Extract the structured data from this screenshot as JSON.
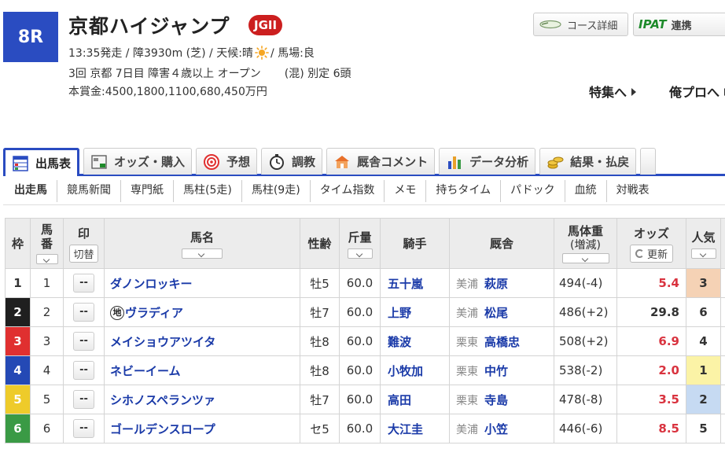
{
  "race": {
    "number": "8R",
    "name": "京都ハイジャンプ",
    "grade": "JGII",
    "data1_a": "13:35発走 / 障3930m (芝) / 天候:晴",
    "data1_b": "/ 馬場:良",
    "weather_icon": "sun-icon",
    "data2_a": "3回 京都 7日目 障害４歳以上 オープン",
    "data2_b": "(混) 別定 6頭",
    "prize": "本賞金:4500,1800,1100,680,450万円"
  },
  "buttons": {
    "course": "コース詳細",
    "ipat_logo": "IPAT",
    "ipat": "連携"
  },
  "links": {
    "tokushu": "特集へ",
    "orepro": "俺プロへ"
  },
  "tabs": [
    {
      "label": "出馬表",
      "icon": "table-icon"
    },
    {
      "label": "オッズ・購入",
      "icon": "ipat-ticket-icon"
    },
    {
      "label": "予想",
      "icon": "target-icon"
    },
    {
      "label": "調教",
      "icon": "stopwatch-icon"
    },
    {
      "label": "厩舎コメント",
      "icon": "stable-icon"
    },
    {
      "label": "データ分析",
      "icon": "bar-chart-icon"
    },
    {
      "label": "結果・払戻",
      "icon": "coins-icon"
    }
  ],
  "subnav": [
    "出走馬",
    "競馬新聞",
    "専門紙",
    "馬柱(5走)",
    "馬柱(9走)",
    "タイム指数",
    "メモ",
    "持ちタイム",
    "パドック",
    "血統",
    "対戦表"
  ],
  "headers": {
    "waku": "枠",
    "umaban": "馬番",
    "mark": "印",
    "mark_btn": "切替",
    "horse": "馬名",
    "sex_age": "性齢",
    "kinryo": "斤量",
    "jockey": "騎手",
    "stable": "厩舎",
    "weight": "馬体重",
    "weight_sub": "(増減)",
    "odds": "オッズ",
    "update": "更新",
    "popularity": "人気"
  },
  "colors": {
    "accent": "#2a4cc1",
    "grade": "#cc1f1f",
    "link": "#1a3aa8",
    "odds_low": "#d9333f"
  },
  "entries": [
    {
      "waku": "1",
      "waku_bg": "#ffffff",
      "waku_fg": "#333333",
      "umaban": "1",
      "mark": "--",
      "horse": "ダノンロッキー",
      "chi": "",
      "sex_age": "牡5",
      "kinryo": "60.0",
      "jockey": "五十嵐",
      "area": "美浦",
      "trainer": "萩原",
      "weight": "494(-4)",
      "odds": "5.4",
      "odds_color": "#d9333f",
      "pop": "3",
      "pop_bg": "#f5d2b5"
    },
    {
      "waku": "2",
      "waku_bg": "#1f1f1f",
      "waku_fg": "#ffffff",
      "umaban": "2",
      "mark": "--",
      "horse": "ヴラディア",
      "chi": "地",
      "sex_age": "牡7",
      "kinryo": "60.0",
      "jockey": "上野",
      "area": "美浦",
      "trainer": "松尾",
      "weight": "486(+2)",
      "odds": "29.8",
      "odds_color": "#333333",
      "pop": "6",
      "pop_bg": "#ffffff"
    },
    {
      "waku": "3",
      "waku_bg": "#e03030",
      "waku_fg": "#ffffff",
      "umaban": "3",
      "mark": "--",
      "horse": "メイショウアツイタ",
      "chi": "",
      "sex_age": "牡8",
      "kinryo": "60.0",
      "jockey": "難波",
      "area": "栗東",
      "trainer": "高橋忠",
      "weight": "508(+2)",
      "odds": "6.9",
      "odds_color": "#d9333f",
      "pop": "4",
      "pop_bg": "#ffffff"
    },
    {
      "waku": "4",
      "waku_bg": "#2449b5",
      "waku_fg": "#ffffff",
      "umaban": "4",
      "mark": "--",
      "horse": "ネビーイーム",
      "chi": "",
      "sex_age": "牡8",
      "kinryo": "60.0",
      "jockey": "小牧加",
      "area": "栗東",
      "trainer": "中竹",
      "weight": "538(-2)",
      "odds": "2.0",
      "odds_color": "#d9333f",
      "pop": "1",
      "pop_bg": "#fbf3a6"
    },
    {
      "waku": "5",
      "waku_bg": "#eecb2a",
      "waku_fg": "#ffffff",
      "umaban": "5",
      "mark": "--",
      "horse": "シホノスペランツァ",
      "chi": "",
      "sex_age": "牡7",
      "kinryo": "60.0",
      "jockey": "高田",
      "area": "栗東",
      "trainer": "寺島",
      "weight": "478(-8)",
      "odds": "3.5",
      "odds_color": "#d9333f",
      "pop": "2",
      "pop_bg": "#c6daf2"
    },
    {
      "waku": "6",
      "waku_bg": "#3a9a45",
      "waku_fg": "#ffffff",
      "umaban": "6",
      "mark": "--",
      "horse": "ゴールデンスロープ",
      "chi": "",
      "sex_age": "セ5",
      "kinryo": "60.0",
      "jockey": "大江圭",
      "area": "美浦",
      "trainer": "小笠",
      "weight": "446(-6)",
      "odds": "8.5",
      "odds_color": "#d9333f",
      "pop": "5",
      "pop_bg": "#ffffff"
    }
  ]
}
